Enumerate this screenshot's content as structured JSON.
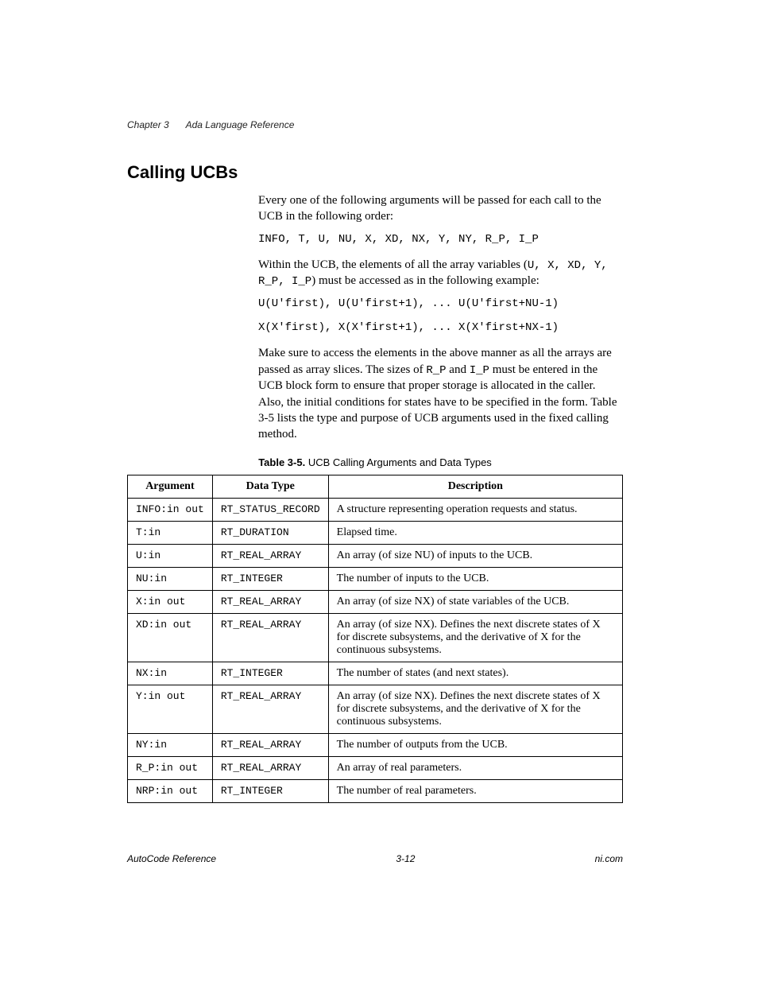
{
  "header": {
    "chapter": "Chapter 3",
    "title": "Ada Language Reference"
  },
  "section": {
    "heading": "Calling UCBs",
    "para1": "Every one of the following arguments will be passed for each call to the UCB in the following order:",
    "code1": "INFO, T, U, NU, X, XD, NX, Y, NY, R_P, I_P",
    "para2_a": "Within the UCB, the elements of all the array variables (",
    "para2_vars": "U, X, XD, Y, R_P, I_P",
    "para2_b": ") must be accessed as in the following example:",
    "code2": "U(U'first), U(U'first+1), ... U(U'first+NU-1)",
    "code3": "X(X'first), X(X'first+1), ... X(X'first+NX-1)",
    "para3_a": "Make sure to access the elements in the above manner as all the arrays are passed as array slices. The sizes of ",
    "para3_rp": "R_P",
    "para3_and": " and ",
    "para3_ip": "I_P",
    "para3_b": " must be entered in the UCB block form to ensure that proper storage is allocated in the caller. Also, the initial conditions for states have to be specified in the form. Table 3-5 lists the type and purpose of UCB arguments used in the fixed calling method."
  },
  "table": {
    "caption_num": "Table 3-5.",
    "caption_text": "  UCB Calling Arguments and Data Types",
    "headers": {
      "c1": "Argument",
      "c2": "Data Type",
      "c3": "Description"
    },
    "rows": [
      {
        "arg": "INFO:in out",
        "dtype": "RT_STATUS_RECORD",
        "desc": "A structure representing operation requests and status."
      },
      {
        "arg": "T:in",
        "dtype": "RT_DURATION",
        "desc": "Elapsed time."
      },
      {
        "arg": "U:in",
        "dtype": "RT_REAL_ARRAY",
        "desc": "An array (of size NU) of inputs to the UCB."
      },
      {
        "arg": "NU:in",
        "dtype": "RT_INTEGER",
        "desc": "The number of inputs to the UCB."
      },
      {
        "arg": "X:in out",
        "dtype": "RT_REAL_ARRAY",
        "desc": "An array (of size NX) of state variables of the UCB."
      },
      {
        "arg": "XD:in out",
        "dtype": "RT_REAL_ARRAY",
        "desc": "An array (of size NX). Defines the next discrete states of X for discrete subsystems, and the derivative of X for the continuous subsystems."
      },
      {
        "arg": "NX:in",
        "dtype": "RT_INTEGER",
        "desc": "The number of states (and next states)."
      },
      {
        "arg": "Y:in out",
        "dtype": "RT_REAL_ARRAY",
        "desc": "An array (of size NX). Defines the next discrete states of X for discrete subsystems, and the derivative of X for the continuous subsystems."
      },
      {
        "arg": "NY:in",
        "dtype": "RT_REAL_ARRAY",
        "desc": "The number of outputs from the UCB."
      },
      {
        "arg": "R_P:in out",
        "dtype": "RT_REAL_ARRAY",
        "desc": "An array of real parameters."
      },
      {
        "arg": "NRP:in out",
        "dtype": "RT_INTEGER",
        "desc": "The number of real parameters."
      }
    ]
  },
  "footer": {
    "left": "AutoCode Reference",
    "center": "3-12",
    "right": "ni.com"
  }
}
